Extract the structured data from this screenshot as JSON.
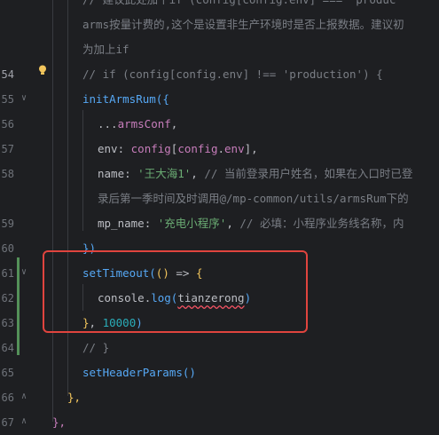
{
  "gutter": {
    "line_numbers": [
      "",
      "",
      "",
      "54",
      "55",
      "56",
      "57",
      "58",
      "",
      "59",
      "60",
      "61",
      "62",
      "63",
      "64",
      "65",
      "66",
      "67"
    ]
  },
  "code": {
    "l_comment1": "// 建议此处加个if (config[config.env] === 'produc",
    "l_comment2": "arms按量计费的,这个是设置非生产环境时是否上报数据。建议初",
    "l_comment3": "为加上if",
    "l54_comment": "// if (config[config.env] !== 'production') {",
    "l55_fn": "initArmsRum",
    "l55_open": "({",
    "l56_spread": "...",
    "l56_id": "armsConf",
    "l56_comma": ",",
    "l57_key": "env",
    "l57_colon": ": ",
    "l57_obj": "config",
    "l57_b1": "[",
    "l57_obj2": "config",
    "l57_dot": ".",
    "l57_prop": "env",
    "l57_b2": "]",
    "l57_comma": ",",
    "l58_key": "name",
    "l58_colon": ": ",
    "l58_str": "'王大海1'",
    "l58_comma": ", ",
    "l58_comment": "// 当前登录用户姓名，如果在入口时已登",
    "l58_cont": "录后第一季时间及时调用@/mp-common/utils/armsRum下的",
    "l59_key": "mp_name",
    "l59_colon": ": ",
    "l59_str": "'充电小程序'",
    "l59_comma": ", ",
    "l59_comment": "//  必填：小程序业务线名称，内",
    "l60_close": "})",
    "l61_fn": "setTimeout",
    "l61_p1": "(",
    "l61_p2": "()",
    "l61_arrow": " => ",
    "l61_brace": "{",
    "l62_obj": "console",
    "l62_dot": ".",
    "l62_fn": "log",
    "l62_p1": "(",
    "l62_arg": "tianzerong",
    "l62_p2": ")",
    "l63_brace": "}",
    "l63_comma": ", ",
    "l63_num": "10000",
    "l63_p": ")",
    "l64_comment": "// }",
    "l65_fn": "setHeaderParams",
    "l65_p": "()",
    "l66_close": "},",
    "l67_close": "},"
  },
  "colors": {
    "background": "#1e1f22",
    "highlight_box": "#e0443e",
    "modified_bar": "#549159"
  }
}
